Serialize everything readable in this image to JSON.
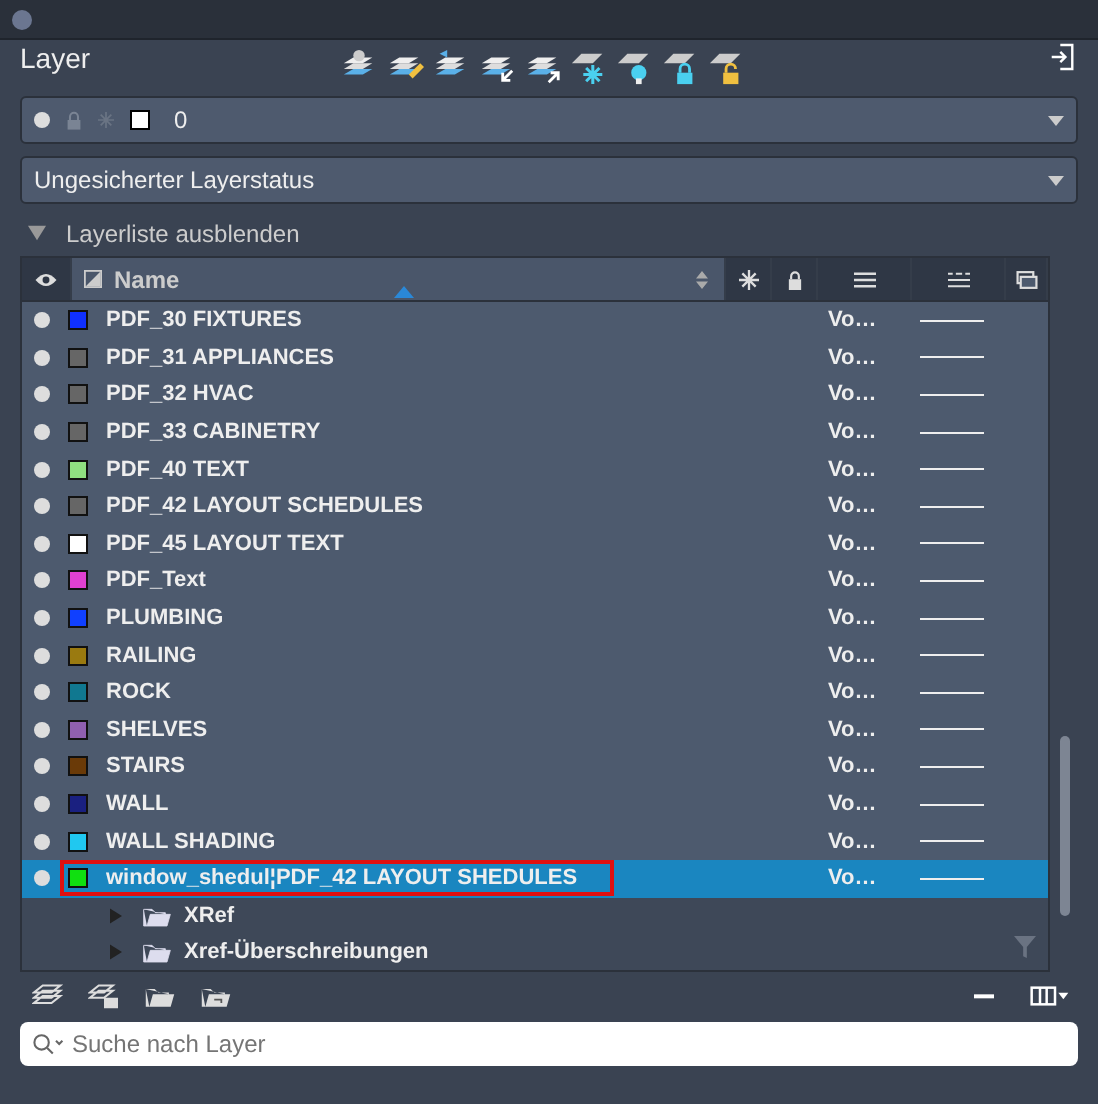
{
  "panel": {
    "title": "Layer"
  },
  "current_layer": {
    "name": "0",
    "color": "#ffffff"
  },
  "state_dropdown": {
    "value": "Ungesicherter Layerstatus"
  },
  "list_toggle": {
    "label": "Layerliste ausblenden",
    "expanded": true
  },
  "table": {
    "columns": [
      "Name"
    ],
    "rows": [
      {
        "name": "PDF_30 FIXTURES",
        "color": "#1030ff",
        "on": true,
        "linetype": "Vo…",
        "selected": false,
        "outlined": false
      },
      {
        "name": "PDF_31 APPLIANCES",
        "color": "#666666",
        "on": true,
        "linetype": "Vo…",
        "selected": false,
        "outlined": false
      },
      {
        "name": "PDF_32 HVAC",
        "color": "#666666",
        "on": true,
        "linetype": "Vo…",
        "selected": false,
        "outlined": false
      },
      {
        "name": "PDF_33 CABINETRY",
        "color": "#666666",
        "on": true,
        "linetype": "Vo…",
        "selected": false,
        "outlined": false
      },
      {
        "name": "PDF_40 TEXT",
        "color": "#90e080",
        "on": true,
        "linetype": "Vo…",
        "selected": false,
        "outlined": false
      },
      {
        "name": "PDF_42 LAYOUT SCHEDULES",
        "color": "#666666",
        "on": true,
        "linetype": "Vo…",
        "selected": false,
        "outlined": false
      },
      {
        "name": "PDF_45 LAYOUT TEXT",
        "color": "#ffffff",
        "on": true,
        "linetype": "Vo…",
        "selected": false,
        "outlined": false
      },
      {
        "name": "PDF_Text",
        "color": "#e040d0",
        "on": true,
        "linetype": "Vo…",
        "selected": false,
        "outlined": false
      },
      {
        "name": "PLUMBING",
        "color": "#1040ff",
        "on": true,
        "linetype": "Vo…",
        "selected": false,
        "outlined": false
      },
      {
        "name": "RAILING",
        "color": "#9a7a10",
        "on": true,
        "linetype": "Vo…",
        "selected": false,
        "outlined": false
      },
      {
        "name": "ROCK",
        "color": "#107890",
        "on": true,
        "linetype": "Vo…",
        "selected": false,
        "outlined": false
      },
      {
        "name": "SHELVES",
        "color": "#9060b0",
        "on": true,
        "linetype": "Vo…",
        "selected": false,
        "outlined": false
      },
      {
        "name": "STAIRS",
        "color": "#6a3a08",
        "on": true,
        "linetype": "Vo…",
        "selected": false,
        "outlined": false
      },
      {
        "name": "WALL",
        "color": "#1a2080",
        "on": true,
        "linetype": "Vo…",
        "selected": false,
        "outlined": false
      },
      {
        "name": "WALL SHADING",
        "color": "#20c8f0",
        "on": true,
        "linetype": "Vo…",
        "selected": false,
        "outlined": false
      },
      {
        "name": "window_shedul¦PDF_42 LAYOUT SHEDULES",
        "color": "#10e010",
        "on": true,
        "linetype": "Vo…",
        "selected": true,
        "outlined": true
      }
    ]
  },
  "groups": [
    {
      "label": "XRef",
      "expanded": false
    },
    {
      "label": "Xref-Überschreibungen",
      "expanded": false
    }
  ],
  "search": {
    "placeholder": "Suche nach Layer"
  }
}
